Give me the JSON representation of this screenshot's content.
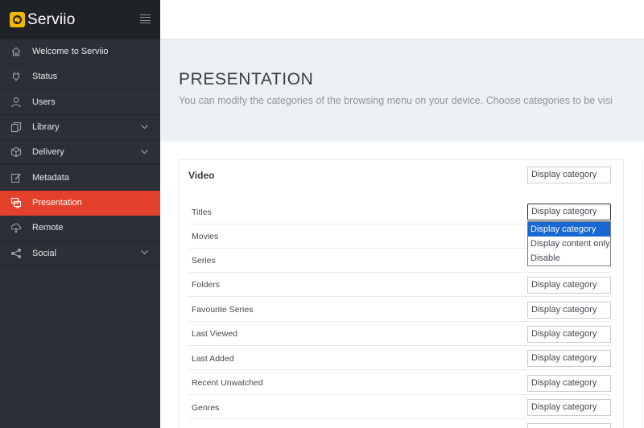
{
  "app": {
    "name": "Serviio"
  },
  "sidebar": {
    "items": [
      {
        "label": "Welcome to Serviio",
        "icon": "home-icon"
      },
      {
        "label": "Status",
        "icon": "plug-icon"
      },
      {
        "label": "Users",
        "icon": "user-icon"
      },
      {
        "label": "Library",
        "icon": "copy-icon",
        "expandable": true
      },
      {
        "label": "Delivery",
        "icon": "box-icon",
        "expandable": true
      },
      {
        "label": "Metadata",
        "icon": "edit-icon"
      },
      {
        "label": "Presentation",
        "icon": "presentation-icon",
        "active": true
      },
      {
        "label": "Remote",
        "icon": "cloud-icon"
      },
      {
        "label": "Social",
        "icon": "share-icon",
        "expandable": true
      }
    ]
  },
  "page": {
    "title": "PRESENTATION",
    "description": "You can modify the categories of the browsing menu on your device. Choose categories to be visi"
  },
  "video": {
    "title": "Video",
    "select_value": "Display category",
    "rows": [
      {
        "label": "Titles",
        "value": "Display category"
      },
      {
        "label": "Movies",
        "value": "Display category"
      },
      {
        "label": "Series",
        "value": "Display category"
      },
      {
        "label": "Folders",
        "value": "Display category"
      },
      {
        "label": "Favourite Series",
        "value": "Display category"
      },
      {
        "label": "Last Viewed",
        "value": "Display category"
      },
      {
        "label": "Last Added",
        "value": "Display category"
      },
      {
        "label": "Recent Unwatched",
        "value": "Display category"
      },
      {
        "label": "Genres",
        "value": "Display category"
      }
    ]
  },
  "dropdown": {
    "options": [
      "Display category",
      "Display content only",
      "Disable"
    ],
    "selected": "Display category"
  },
  "colors": {
    "accent": "#e3412b",
    "sidebar": "#2b3036",
    "logo": "#f5b800",
    "select_highlight": "#1967d2"
  }
}
